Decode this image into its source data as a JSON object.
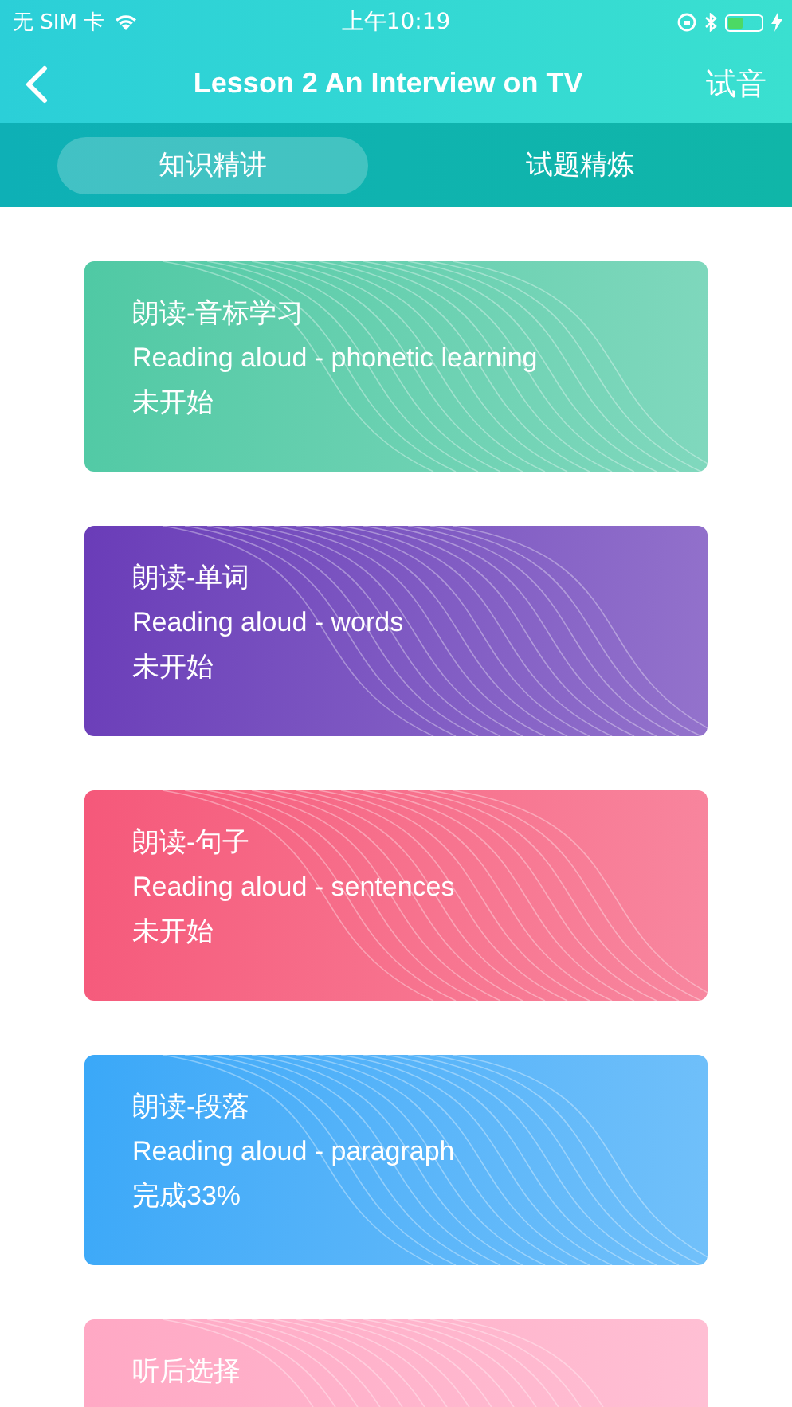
{
  "status_bar": {
    "carrier": "无 SIM 卡",
    "time": "上午10:19"
  },
  "nav": {
    "title": "Lesson 2 An Interview on TV",
    "action": "试音"
  },
  "tabs": [
    {
      "label": "知识精讲",
      "selected": true
    },
    {
      "label": "试题精炼",
      "selected": false
    }
  ],
  "cards": [
    {
      "title": "朗读-音标学习",
      "subtitle": "Reading aloud - phonetic learning",
      "status": "未开始",
      "color": "#4fc9a4"
    },
    {
      "title": "朗读-单词",
      "subtitle": "Reading aloud - words",
      "status": "未开始",
      "color": "#6a3cb8"
    },
    {
      "title": "朗读-句子",
      "subtitle": "Reading aloud - sentences",
      "status": "未开始",
      "color": "#f5587a"
    },
    {
      "title": "朗读-段落",
      "subtitle": "Reading aloud - paragraph",
      "status": "完成33%",
      "color": "#3aa8f8"
    },
    {
      "title": "听后选择",
      "color": "#ffa8c4"
    }
  ]
}
